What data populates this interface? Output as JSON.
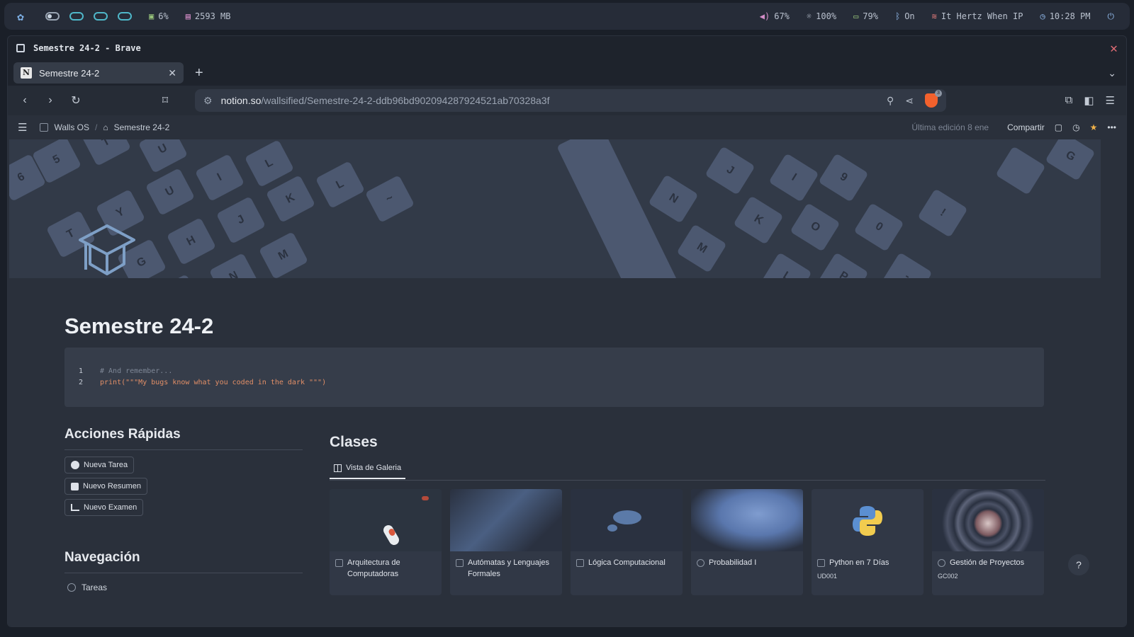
{
  "sysbar": {
    "cpu": "6%",
    "ram": "2593 MB",
    "volume": "67%",
    "brightness": "100%",
    "battery": "79%",
    "bluetooth": "On",
    "wifi": "It Hertz When IP",
    "time": "10:28 PM"
  },
  "window": {
    "title": "Semestre 24-2 - Brave"
  },
  "tab": {
    "label": "Semestre 24-2",
    "icon": "notion-icon"
  },
  "url": {
    "host": "notion.so",
    "path": "/wallsified/Semestre-24-2-ddb96bd902094287924521ab70328a3f"
  },
  "notion": {
    "breadcrumb": [
      "Walls OS",
      "Semestre 24-2"
    ],
    "edited": "Última edición 8 ene",
    "share": "Compartir",
    "title": "Semestre 24-2",
    "code": {
      "line1_no": "1",
      "line1": "# And remember...",
      "line2_no": "2",
      "line2": "print(\"\"\"My bugs know what you coded in the dark \"\"\")"
    },
    "quick_actions": {
      "heading": "Acciones Rápidas",
      "buttons": [
        "Nueva Tarea",
        "Nuevo Resumen",
        "Nuevo Examen"
      ]
    },
    "navigation": {
      "heading": "Navegación",
      "items": [
        "Tareas"
      ]
    },
    "classes": {
      "heading": "Clases",
      "view": "Vista de Galeria",
      "cards": [
        {
          "title": "Arquitectura de Computadoras",
          "code": ""
        },
        {
          "title": "Autómatas y Lenguajes Formales",
          "code": ""
        },
        {
          "title": "Lógica Computacional",
          "code": ""
        },
        {
          "title": "Probabilidad I",
          "code": ""
        },
        {
          "title": "Python en 7 Días",
          "code": "UD001"
        },
        {
          "title": "Gestión de Proyectos",
          "code": "GC002"
        }
      ]
    },
    "help": "?"
  },
  "colors": {
    "accent_star": "#f0b24a",
    "code_string": "#e28f67",
    "close_red": "#e06c75"
  }
}
